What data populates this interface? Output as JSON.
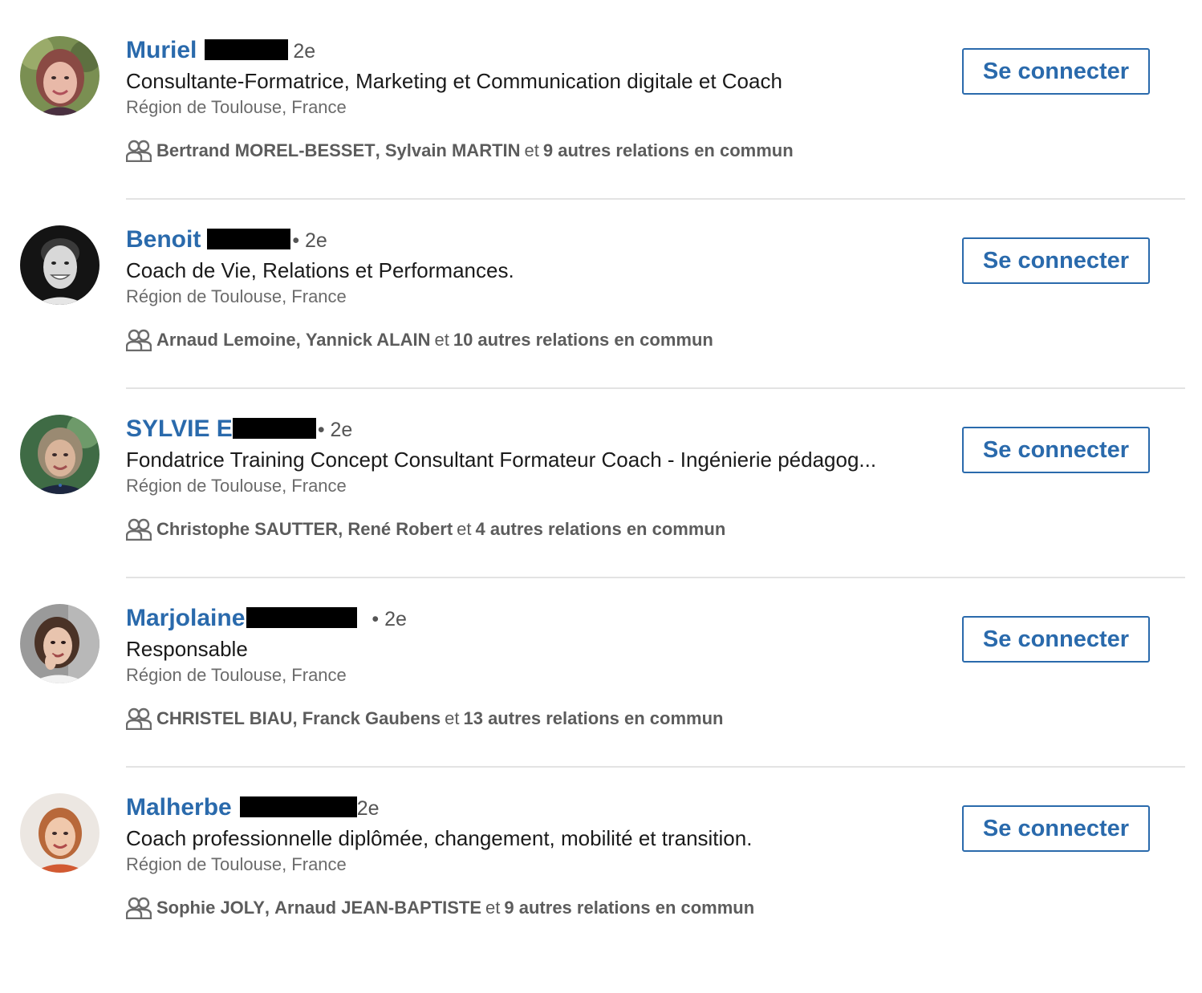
{
  "results": [
    {
      "name": "Muriel",
      "degree": "2e",
      "headline": "Consultante-Formatrice, Marketing et Communication digitale et Coach",
      "location": "Région de Toulouse, France",
      "shared": {
        "person1": "Bertrand MOREL-BESSET",
        "person2": "Sylvain MARTIN",
        "conj": "et",
        "others": "9 autres relations en commun"
      },
      "button": "Se connecter"
    },
    {
      "name": "Benoit",
      "degree": "• 2e",
      "headline": "Coach de Vie, Relations et Performances.",
      "location": "Région de Toulouse, France",
      "shared": {
        "person1": "Arnaud Lemoine",
        "person2": "Yannick ALAIN",
        "conj": "et",
        "others": "10 autres relations en commun"
      },
      "button": "Se connecter"
    },
    {
      "name": "SYLVIE E",
      "degree": "• 2e",
      "headline": "Fondatrice Training Concept Consultant Formateur Coach - Ingénierie pédagog...",
      "location": "Région de Toulouse, France",
      "shared": {
        "person1": "Christophe SAUTTER",
        "person2": "René Robert",
        "conj": "et",
        "others": "4 autres relations en commun"
      },
      "button": "Se connecter"
    },
    {
      "name": "Marjolaine",
      "degree": "• 2e",
      "headline": "Responsable",
      "location": "Région de Toulouse, France",
      "shared": {
        "person1": "CHRISTEL BIAU",
        "person2": "Franck Gaubens",
        "conj": "et",
        "others": "13 autres relations en commun"
      },
      "button": "Se connecter"
    },
    {
      "name": "Malherbe",
      "degree": "2e",
      "headline": "Coach professionnelle diplômée, changement, mobilité et transition.",
      "location": "Région de Toulouse, France",
      "shared": {
        "person1": "Sophie JOLY",
        "person2": "Arnaud JEAN-BAPTISTE",
        "conj": "et",
        "others": "9 autres relations en commun"
      },
      "button": "Se connecter"
    }
  ],
  "icons": {
    "shared_connections": "people-icon"
  },
  "colors": {
    "link_blue": "#2a6aac",
    "text_dark": "#1a1a1a",
    "text_muted": "#6b6b6b",
    "divider": "#e3e3e3",
    "redaction": "#000000"
  }
}
